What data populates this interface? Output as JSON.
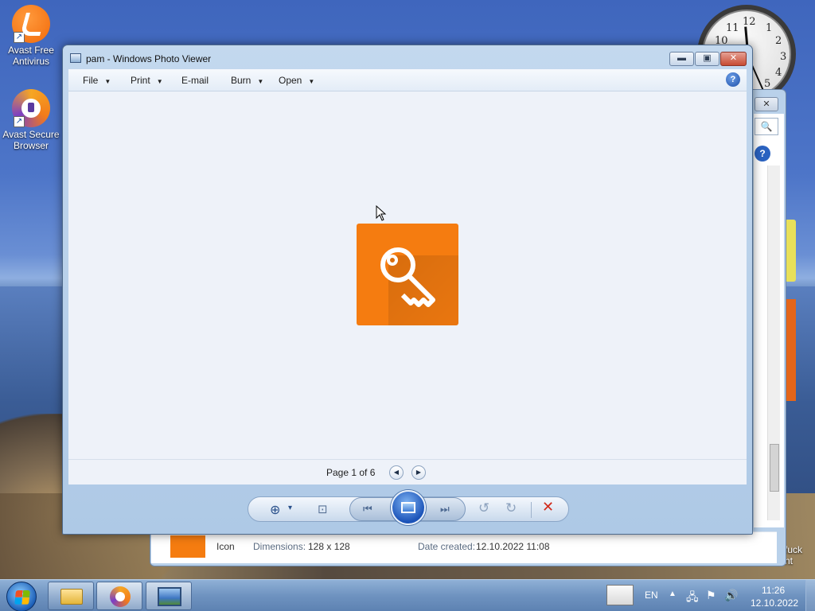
{
  "desktop": {
    "icons": [
      {
        "label_line1": "Avast Free",
        "label_line2": "Antivirus",
        "icon": "avast-antivirus-icon"
      },
      {
        "label_line1": "Avast Secure",
        "label_line2": "Browser",
        "icon": "avast-browser-icon"
      }
    ],
    "clock_numbers": [
      "12",
      "1",
      "2",
      "3",
      "4",
      "5",
      "10",
      "11"
    ],
    "side_text_line1": "fuck",
    "side_text_line2": "nt"
  },
  "background_window": {
    "close_label": "✕",
    "search_icon": "🔍",
    "help_label": "?",
    "details": {
      "type_value": "Icon",
      "dimensions_label": "Dimensions:",
      "dimensions_value": "128 x 128",
      "date_label": "Date created:",
      "date_value": "12.10.2022 11:08"
    }
  },
  "window": {
    "title": "pam - Windows Photo Viewer",
    "minimize_label": "▬",
    "maximize_label": "▣",
    "close_label": "✕"
  },
  "menu": {
    "items": [
      {
        "label": "File",
        "has_dropdown": true
      },
      {
        "label": "Print",
        "has_dropdown": true
      },
      {
        "label": "E-mail",
        "has_dropdown": false
      },
      {
        "label": "Burn",
        "has_dropdown": true
      },
      {
        "label": "Open",
        "has_dropdown": true
      }
    ],
    "dropdown_glyph": "▼",
    "help_label": "?"
  },
  "viewer": {
    "image_description_icon": "key-icon",
    "image_color": "#f57c10",
    "page_label": "Page 1 of 6",
    "prev_glyph": "◀",
    "next_glyph": "▶"
  },
  "controls": {
    "zoom_glyph": "⊕",
    "zoom_arrow": "▾",
    "fit_glyph": "⊡",
    "previous_glyph": "⏮",
    "next_glyph": "⏭",
    "rotate_ccw_glyph": "↺",
    "rotate_cw_glyph": "↻",
    "delete_glyph": "✕",
    "delete_color": "#d12a1a"
  },
  "taskbar": {
    "language": "EN",
    "tray_up_arrow": "▲",
    "tray_network_glyph": "🖧",
    "tray_flag_glyph": "⚑",
    "tray_volume_glyph": "🔊",
    "time": "11:26",
    "date": "12.10.2022"
  }
}
